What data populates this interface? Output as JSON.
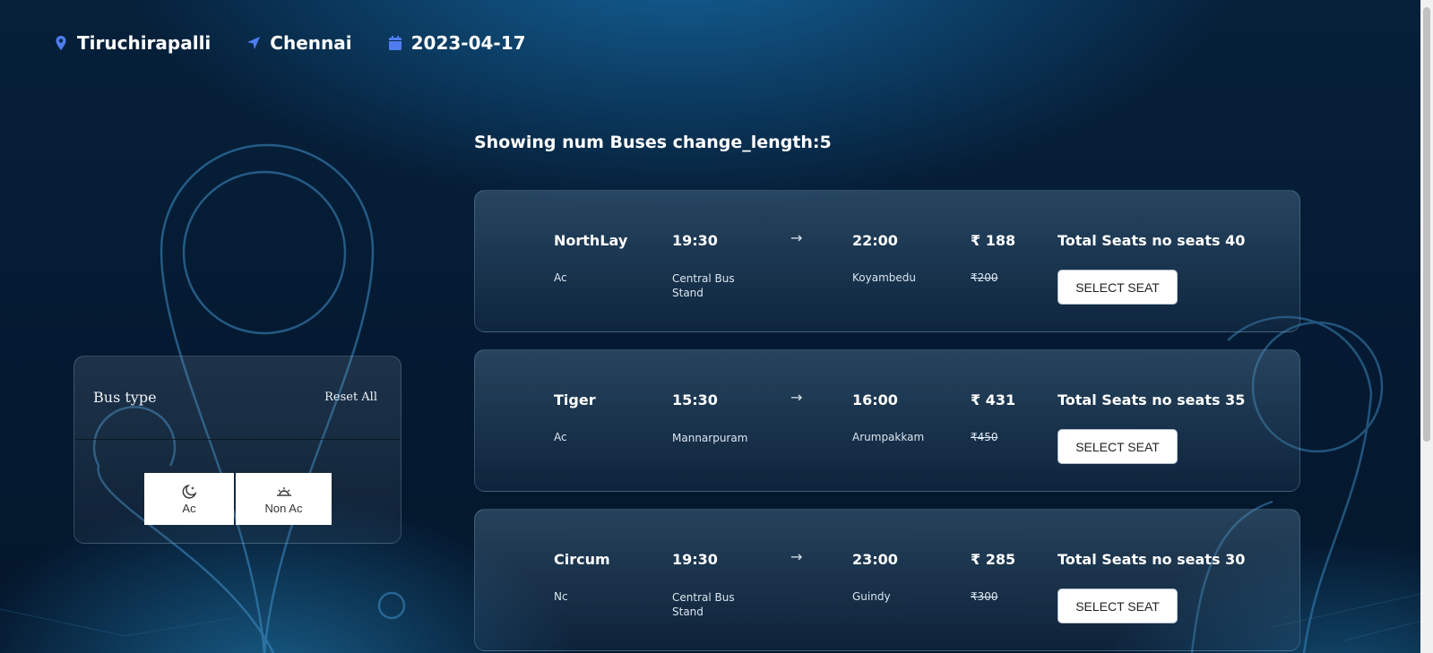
{
  "header": {
    "from": "Tiruchirapalli",
    "to": "Chennai",
    "date": "2023-04-17",
    "from_icon": "map-pin-icon",
    "to_icon": "navigation-arrow-icon",
    "date_icon": "calendar-icon"
  },
  "results": {
    "showing_text": "Showing num Buses change_length:5"
  },
  "filter": {
    "title": "Bus type",
    "reset_label": "Reset All",
    "options": [
      {
        "label": "Ac",
        "icon": "moon-stars-icon"
      },
      {
        "label": "Non Ac",
        "icon": "sun-icon"
      }
    ]
  },
  "buses": [
    {
      "name": "NorthLay",
      "type": "Ac",
      "departure_time": "19:30",
      "departure_location": "Central Bus Stand",
      "arrow": "→",
      "arrival_time": "22:00",
      "arrival_location": "Koyambedu",
      "price": "₹ 188",
      "old_price": "₹200",
      "seats": "Total Seats no seats 40",
      "button_label": "SELECT SEAT"
    },
    {
      "name": "Tiger",
      "type": "Ac",
      "departure_time": "15:30",
      "departure_location": "Mannarpuram",
      "arrow": "→",
      "arrival_time": "16:00",
      "arrival_location": "Arumpakkam",
      "price": "₹ 431",
      "old_price": "₹450",
      "seats": "Total Seats no seats 35",
      "button_label": "SELECT SEAT"
    },
    {
      "name": "Circum",
      "type": "Nc",
      "departure_time": "19:30",
      "departure_location": "Central Bus Stand",
      "arrow": "→",
      "arrival_time": "23:00",
      "arrival_location": "Guindy",
      "price": "₹ 285",
      "old_price": "₹300",
      "seats": "Total Seats no seats 30",
      "button_label": "SELECT SEAT"
    }
  ],
  "colors": {
    "accent_icon": "#4f7df0",
    "card_border": "#8cb4d2",
    "glow": "#3aa0e0"
  }
}
